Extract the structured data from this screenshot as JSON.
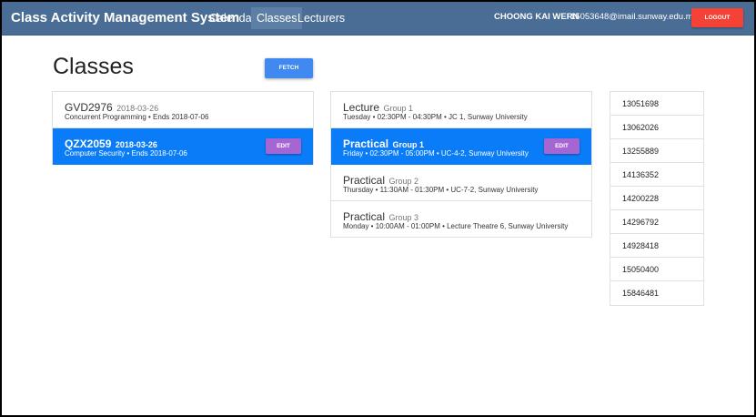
{
  "navbar": {
    "brand": "Class Activity Management System",
    "links": [
      {
        "label": "Calendar",
        "active": false
      },
      {
        "label": "Classes",
        "active": true
      },
      {
        "label": "Lecturers",
        "active": false
      }
    ],
    "user_name": "CHOONG KAI WERN",
    "user_email": "15053648@imail.sunway.edu.my",
    "logout_label": "LOGOUT"
  },
  "page": {
    "title": "Classes",
    "fetch_label": "FETCH"
  },
  "classes": [
    {
      "code": "GVD2976",
      "date": "2018-03-26",
      "desc": "Concurrent Programming • Ends 2018-07-06",
      "selected": false
    },
    {
      "code": "QZX2059",
      "date": "2018-03-26",
      "desc": "Computer Security • Ends 2018-07-06",
      "selected": true,
      "edit_label": "EDIT"
    }
  ],
  "sessions": [
    {
      "type": "Lecture",
      "group": "Group 1",
      "desc": "Tuesday • 02:30PM - 04:30PM • JC 1, Sunway University",
      "selected": false
    },
    {
      "type": "Practical",
      "group": "Group 1",
      "desc": "Friday • 02:30PM - 05:00PM • UC-4-2, Sunway University",
      "selected": true,
      "edit_label": "EDIT"
    },
    {
      "type": "Practical",
      "group": "Group 2",
      "desc": "Thursday • 11:30AM - 01:30PM • UC-7-2, Sunway University",
      "selected": false
    },
    {
      "type": "Practical",
      "group": "Group 3",
      "desc": "Monday • 10:00AM - 01:00PM • Lecture Theatre 6, Sunway University",
      "selected": false
    }
  ],
  "students": [
    "13051698",
    "13062026",
    "13255889",
    "14136352",
    "14200228",
    "14296792",
    "14928418",
    "15050400",
    "15846481"
  ],
  "colors": {
    "navbar": "#4a6d96",
    "selected": "#0a7cf8",
    "edit": "#a566d3",
    "fetch": "#3f89f0",
    "logout": "#f44336"
  }
}
